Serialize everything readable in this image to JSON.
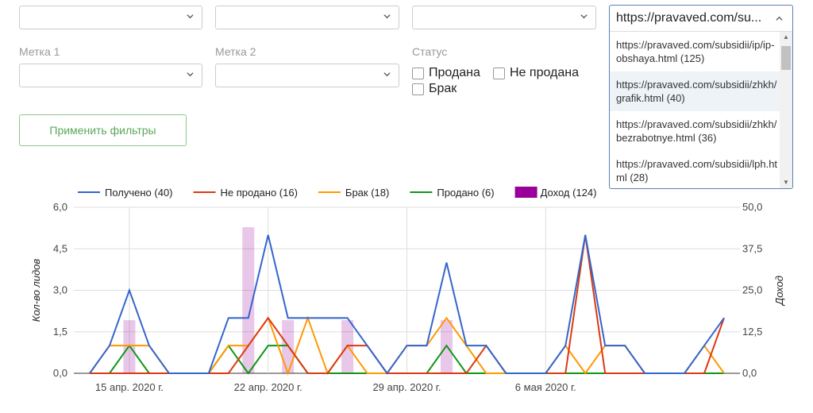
{
  "filters": {
    "label1": "Метка 1",
    "label2": "Метка 2",
    "status_label": "Статус",
    "status_options": [
      "Продана",
      "Не продана",
      "Брак"
    ],
    "apply_button": "Применить фильтры"
  },
  "url_dropdown": {
    "selected": "https://pravaved.com/su...",
    "options": [
      "https://pravaved.com/subsidii/ip/ip-obshaya.html (125)",
      "https://pravaved.com/subsidii/zhkh/grafik.html (40)",
      "https://pravaved.com/subsidii/zhkh/bezrabotnye.html (36)",
      "https://pravaved.com/subsidii/lph.html (28)"
    ]
  },
  "chart_data": {
    "type": "line",
    "ylabel": "Кол-во лидов",
    "y2label": "Доход",
    "ylim": [
      0,
      6
    ],
    "y2lim": [
      0,
      50
    ],
    "yticks": [
      "0,0",
      "1,5",
      "3,0",
      "4,5",
      "6,0"
    ],
    "y2ticks": [
      "0,0",
      "12,5",
      "25,0",
      "37,5",
      "50,0"
    ],
    "x_labels": [
      "15 апр. 2020 г.",
      "22 апр. 2020 г.",
      "29 апр. 2020 г.",
      "6 мая 2020 г."
    ],
    "x_label_index": [
      2,
      9,
      16,
      23
    ],
    "num_days": 31,
    "series": [
      {
        "name": "Получено (40)",
        "color": "#3366cc",
        "values": [
          0,
          1,
          3,
          1,
          0,
          0,
          0,
          2,
          2,
          5,
          2,
          2,
          2,
          2,
          1,
          0,
          1,
          1,
          4,
          1,
          1,
          0,
          0,
          0,
          1,
          5,
          1,
          1,
          0,
          0,
          0,
          1,
          2
        ]
      },
      {
        "name": "Не продано (16)",
        "color": "#dc3912",
        "values": [
          0,
          0,
          0,
          0,
          0,
          0,
          0,
          0,
          1,
          2,
          1,
          0,
          0,
          1,
          1,
          0,
          0,
          0,
          0,
          0,
          1,
          0,
          0,
          0,
          0,
          5,
          0,
          0,
          0,
          0,
          0,
          0,
          2
        ]
      },
      {
        "name": "Брак (18)",
        "color": "#ff9900",
        "values": [
          0,
          1,
          1,
          1,
          0,
          0,
          0,
          1,
          1,
          2,
          0,
          2,
          0,
          1,
          0,
          0,
          1,
          1,
          2,
          1,
          0,
          0,
          0,
          0,
          1,
          0,
          1,
          1,
          0,
          0,
          0,
          1,
          0
        ]
      },
      {
        "name": "Продано (6)",
        "color": "#109618",
        "values": [
          0,
          0,
          1,
          0,
          0,
          0,
          0,
          1,
          0,
          1,
          1,
          0,
          0,
          0,
          0,
          0,
          0,
          0,
          1,
          0,
          0,
          0,
          0,
          0,
          0,
          0,
          0,
          0,
          0,
          0,
          0,
          0,
          0
        ]
      }
    ],
    "bar_series": {
      "name": "Доход (124)",
      "color": "#990099",
      "values": [
        0,
        0,
        16,
        0,
        0,
        0,
        0,
        0,
        44,
        0,
        16,
        0,
        0,
        16,
        0,
        0,
        0,
        0,
        16,
        0,
        0,
        0,
        0,
        0,
        0,
        0,
        0,
        0,
        0,
        0,
        0,
        0,
        0
      ]
    }
  }
}
